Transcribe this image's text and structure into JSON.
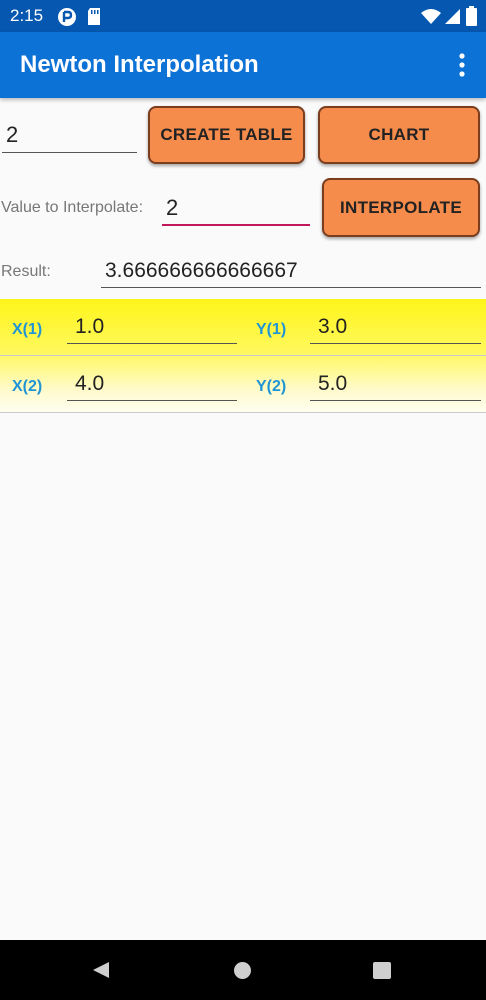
{
  "status_bar": {
    "time": "2:15",
    "icons": [
      "app-notification-icon",
      "sd-card-icon",
      "wifi-icon",
      "signal-icon",
      "battery-icon"
    ]
  },
  "app_bar": {
    "title": "Newton Interpolation",
    "menu_icon": "more-vert-icon"
  },
  "controls": {
    "points_count": "2",
    "create_table_label": "CREATE TABLE",
    "chart_label": "CHART",
    "value_label": "Value to Interpolate:",
    "value_input": "2",
    "interpolate_label": "INTERPOLATE",
    "result_label": "Result:",
    "result_value": "3.666666666666667"
  },
  "table": {
    "rows": [
      {
        "x_label": "X(1)",
        "x_value": "1.0",
        "y_label": "Y(1)",
        "y_value": "3.0"
      },
      {
        "x_label": "X(2)",
        "x_value": "4.0",
        "y_label": "Y(2)",
        "y_value": "5.0"
      }
    ]
  },
  "colors": {
    "status_bar": "#0557b0",
    "app_bar": "#0d72d6",
    "button": "#f58c4c",
    "button_border": "#7a3d1e",
    "table_label": "#1f95d6",
    "active_underline": "#c2185b",
    "table_background": "#fff51a"
  },
  "navigation": {
    "buttons": [
      "back-icon",
      "home-icon",
      "recents-icon"
    ]
  }
}
